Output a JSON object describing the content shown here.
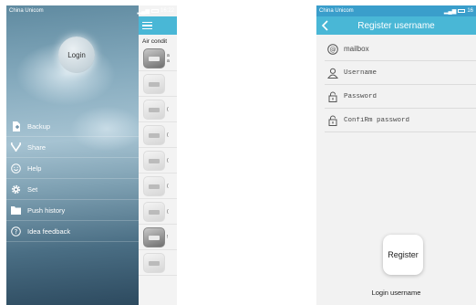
{
  "left": {
    "status": {
      "carrier": "China Unicom",
      "time": "16:22"
    },
    "drawer": {
      "login_label": "Login",
      "menu": [
        {
          "label": "Backup",
          "icon": "backup-icon"
        },
        {
          "label": "Share",
          "icon": "share-icon"
        },
        {
          "label": "Help",
          "icon": "help-icon"
        },
        {
          "label": "Set",
          "icon": "gear-icon"
        },
        {
          "label": "Push history",
          "icon": "folder-icon"
        },
        {
          "label": "Idea feedback",
          "icon": "question-icon"
        }
      ]
    },
    "list": {
      "title": "Air condit"
    }
  },
  "right": {
    "status": {
      "carrier": "China Unicom",
      "time": "16"
    },
    "title": "Register username",
    "fields": {
      "mailbox": "mailbox",
      "username": "Username",
      "password": "Password",
      "confirm": "ConfiRm password"
    },
    "register_label": "Register",
    "login_link": "Login username"
  },
  "colors": {
    "accent": "#49b7d6"
  }
}
